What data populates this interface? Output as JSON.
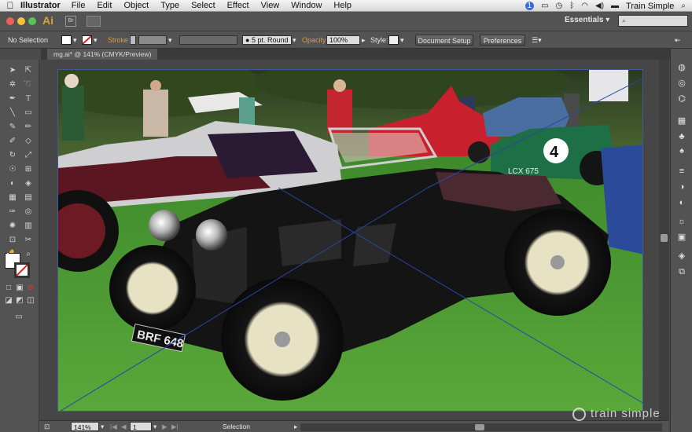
{
  "menubar": {
    "app_name": "Illustrator",
    "items": [
      "File",
      "Edit",
      "Object",
      "Type",
      "Select",
      "Effect",
      "View",
      "Window",
      "Help"
    ],
    "status_badge": "1",
    "brand": "Train Simple"
  },
  "appbar": {
    "logo": "Ai",
    "bridge_label": "Br",
    "workspace": "Essentials"
  },
  "control": {
    "selection": "No Selection",
    "stroke_label": "Stroke:",
    "brush": "5 pt. Round",
    "opacity_label": "Opacity:",
    "opacity_value": "100%",
    "style_label": "Style:",
    "doc_setup": "Document Setup",
    "preferences": "Preferences"
  },
  "document": {
    "tab_title": "mg.ai* @ 141% (CMYK/Preview)"
  },
  "status": {
    "zoom": "141%",
    "artboard": "1",
    "tool": "Selection"
  },
  "watermark": "train simple",
  "plate_text": "BRF 648",
  "green_car_number": "4",
  "green_car_plate": "LCX 675",
  "colors": {
    "accent": "#e89440",
    "car_black": "#141414",
    "grass": "#3e8c2c",
    "maroon": "#5a1722",
    "red_car": "#c8202c",
    "green_car": "#1d6f46"
  }
}
